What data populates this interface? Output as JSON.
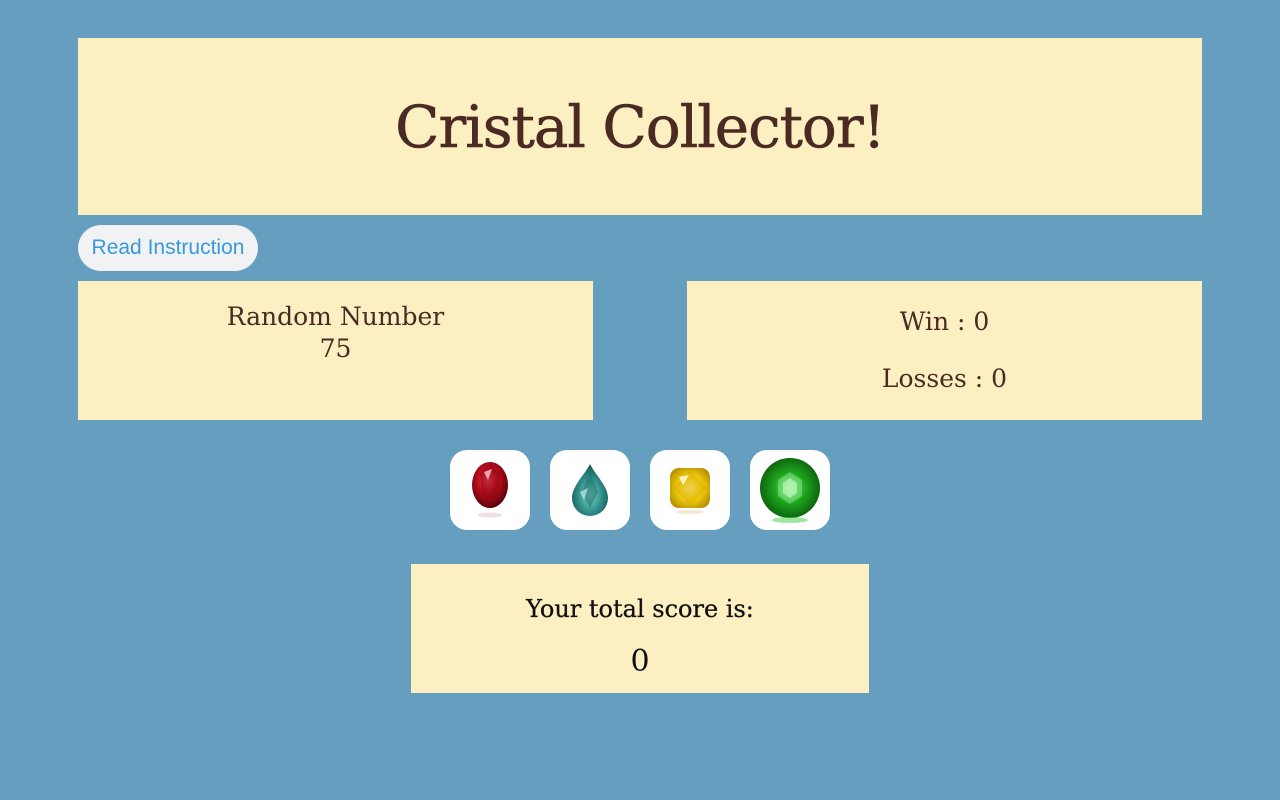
{
  "header": {
    "title": "Cristal Collector!"
  },
  "instructions_button": {
    "label": "Read Instruction"
  },
  "random_panel": {
    "label": "Random Number",
    "value": "75"
  },
  "record_panel": {
    "wins": "Win : 0",
    "losses": "Losses : 0"
  },
  "gems": [
    {
      "icon": "ruby-icon",
      "color": "#b0101e"
    },
    {
      "icon": "teal-sapphire-icon",
      "color": "#2f8f8a"
    },
    {
      "icon": "yellow-diamond-icon",
      "color": "#f2cf10"
    },
    {
      "icon": "emerald-icon",
      "color": "#1fa81f"
    }
  ],
  "total_panel": {
    "label": "Your total score is:",
    "value": "0"
  },
  "colors": {
    "background": "#669ebf",
    "panel": "#fcefc1",
    "title_text": "#4a2a22",
    "button_text": "#3a9ad9"
  }
}
